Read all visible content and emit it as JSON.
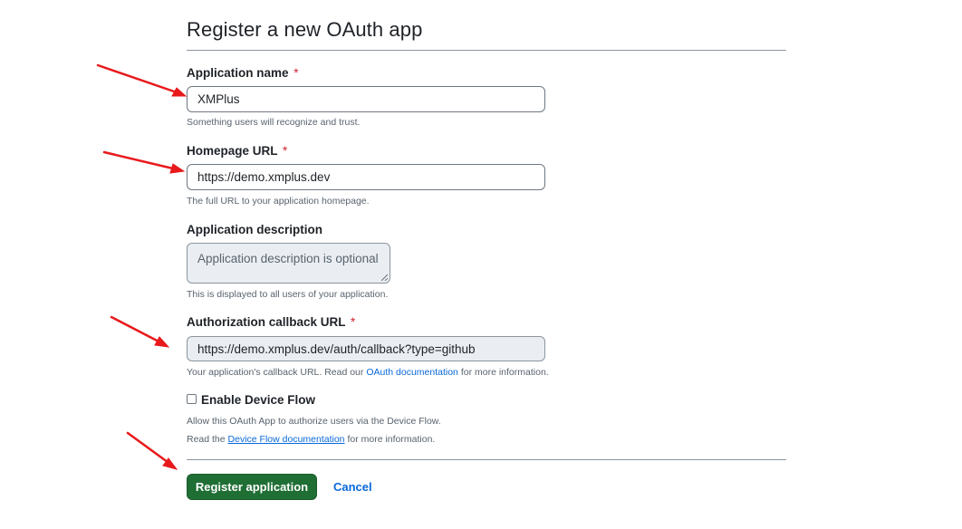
{
  "page": {
    "title": "Register a new OAuth app"
  },
  "form": {
    "app_name": {
      "label": "Application name",
      "required_mark": "*",
      "value": "XMPlus",
      "note": "Something users will recognize and trust."
    },
    "homepage_url": {
      "label": "Homepage URL",
      "required_mark": "*",
      "value": "https://demo.xmplus.dev",
      "note": "The full URL to your application homepage."
    },
    "description": {
      "label": "Application description",
      "placeholder": "Application description is optional",
      "note": "This is displayed to all users of your application."
    },
    "callback_url": {
      "label": "Authorization callback URL",
      "required_mark": "*",
      "value": "https://demo.xmplus.dev/auth/callback?type=github",
      "note_prefix": "Your application's callback URL. Read our",
      "note_link": "OAuth documentation",
      "note_suffix": "for more information."
    },
    "device_flow": {
      "label": "Enable Device Flow",
      "checked": false,
      "note_line1": "Allow this OAuth App to authorize users via the Device Flow.",
      "note_line2_prefix": "Read the",
      "note_link": "Device Flow documentation",
      "note_line2_suffix": "for more information."
    }
  },
  "actions": {
    "submit_label": "Register application",
    "cancel_label": "Cancel"
  },
  "colors": {
    "primary_button": "#1f6e34",
    "link": "#0969da",
    "required": "#cf222e",
    "annotation_arrow": "#e8191b"
  }
}
